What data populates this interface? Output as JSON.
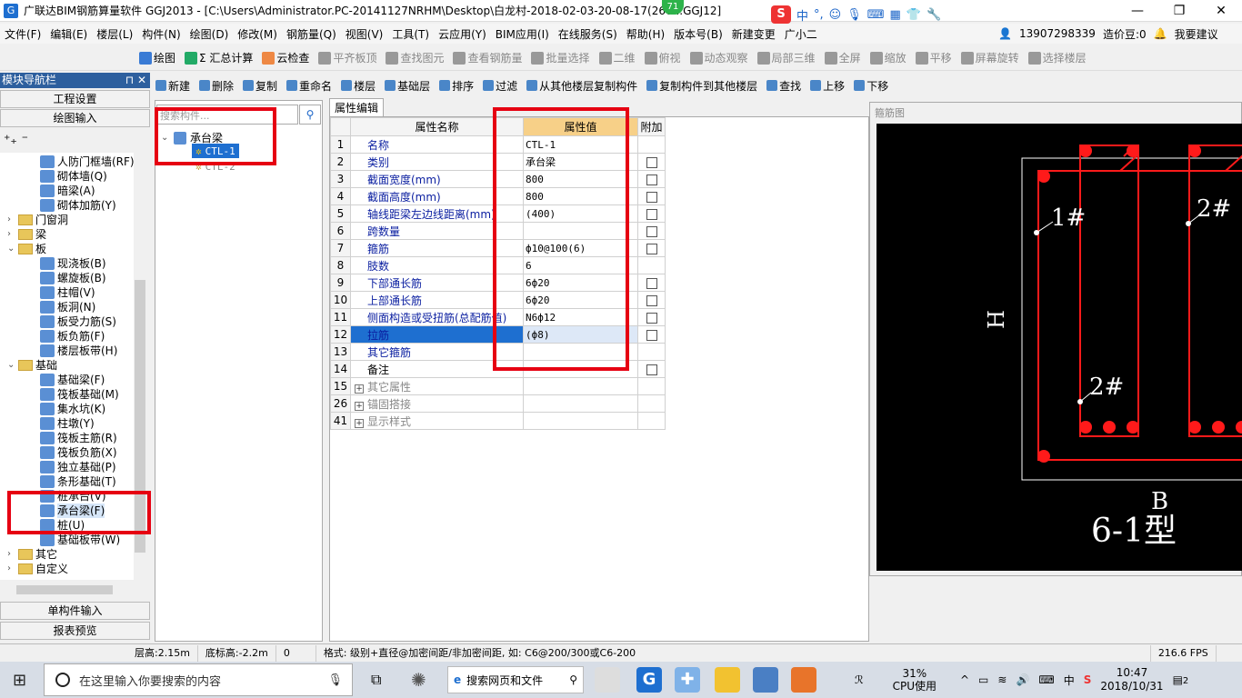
{
  "window": {
    "title": "广联达BIM钢筋算量软件 GGJ2013 - [C:\\Users\\Administrator.PC-20141127NRHM\\Desktop\\白龙村-2018-02-03-20-08-17(260...GGJ12]",
    "badge": "71",
    "min": "—",
    "max": "❐",
    "close": "✕"
  },
  "ime": {
    "logo": "S",
    "lang": "中",
    "punct": "°,"
  },
  "menu": [
    "文件(F)",
    "编辑(E)",
    "楼层(L)",
    "构件(N)",
    "绘图(D)",
    "修改(M)",
    "钢筋量(Q)",
    "视图(V)",
    "工具(T)",
    "云应用(Y)",
    "BIM应用(I)",
    "在线服务(S)",
    "帮助(H)",
    "版本号(B)",
    "新建变更",
    "广小二"
  ],
  "menu_right": {
    "phone": "13907298339",
    "price": "造价豆:0",
    "suggest": "我要建议"
  },
  "toolbar1": [
    {
      "label": "绘图",
      "dis": false
    },
    {
      "label": "Σ 汇总计算",
      "dis": false
    },
    {
      "label": "云检查",
      "dis": false
    },
    {
      "label": "平齐板顶",
      "dis": true
    },
    {
      "label": "查找图元",
      "dis": true
    },
    {
      "label": "查看钢筋量",
      "dis": true
    },
    {
      "label": "批量选择",
      "dis": true
    },
    {
      "label": "二维",
      "dis": true
    },
    {
      "label": "俯视",
      "dis": true
    },
    {
      "label": "动态观察",
      "dis": true
    },
    {
      "label": "局部三维",
      "dis": true
    },
    {
      "label": "全屏",
      "dis": true
    },
    {
      "label": "缩放",
      "dis": true
    },
    {
      "label": "平移",
      "dis": true
    },
    {
      "label": "屏幕旋转",
      "dis": true
    },
    {
      "label": "选择楼层",
      "dis": true
    }
  ],
  "toolbar2": [
    {
      "label": "新建"
    },
    {
      "label": "删除"
    },
    {
      "label": "复制"
    },
    {
      "label": "重命名"
    },
    {
      "label": "楼层"
    },
    {
      "label": "基础层"
    },
    {
      "label": "排序"
    },
    {
      "label": "过滤"
    },
    {
      "label": "从其他楼层复制构件"
    },
    {
      "label": "复制构件到其他楼层"
    },
    {
      "label": "查找"
    },
    {
      "label": "上移"
    },
    {
      "label": "下移"
    }
  ],
  "nav": {
    "title": "模块导航栏",
    "pin": "⊓ ✕",
    "setup": "工程设置",
    "draw_input": "绘图输入",
    "single_input": "单构件输入",
    "report": "报表预览",
    "tree": [
      {
        "label": "人防门框墙(RF)",
        "lvl": 2,
        "type": "item"
      },
      {
        "label": "砌体墙(Q)",
        "lvl": 2,
        "type": "item"
      },
      {
        "label": "暗梁(A)",
        "lvl": 2,
        "type": "item"
      },
      {
        "label": "砌体加筋(Y)",
        "lvl": 2,
        "type": "item"
      },
      {
        "label": "门窗洞",
        "lvl": 1,
        "type": "folder",
        "exp": "›"
      },
      {
        "label": "梁",
        "lvl": 1,
        "type": "folder",
        "exp": "›"
      },
      {
        "label": "板",
        "lvl": 1,
        "type": "folder",
        "exp": "⌄"
      },
      {
        "label": "现浇板(B)",
        "lvl": 2,
        "type": "item"
      },
      {
        "label": "螺旋板(B)",
        "lvl": 2,
        "type": "item"
      },
      {
        "label": "柱帽(V)",
        "lvl": 2,
        "type": "item"
      },
      {
        "label": "板洞(N)",
        "lvl": 2,
        "type": "item"
      },
      {
        "label": "板受力筋(S)",
        "lvl": 2,
        "type": "item"
      },
      {
        "label": "板负筋(F)",
        "lvl": 2,
        "type": "item"
      },
      {
        "label": "楼层板带(H)",
        "lvl": 2,
        "type": "item"
      },
      {
        "label": "基础",
        "lvl": 1,
        "type": "folder",
        "exp": "⌄"
      },
      {
        "label": "基础梁(F)",
        "lvl": 2,
        "type": "item"
      },
      {
        "label": "筏板基础(M)",
        "lvl": 2,
        "type": "item"
      },
      {
        "label": "集水坑(K)",
        "lvl": 2,
        "type": "item"
      },
      {
        "label": "柱墩(Y)",
        "lvl": 2,
        "type": "item"
      },
      {
        "label": "筏板主筋(R)",
        "lvl": 2,
        "type": "item"
      },
      {
        "label": "筏板负筋(X)",
        "lvl": 2,
        "type": "item"
      },
      {
        "label": "独立基础(P)",
        "lvl": 2,
        "type": "item"
      },
      {
        "label": "条形基础(T)",
        "lvl": 2,
        "type": "item"
      },
      {
        "label": "桩承台(V)",
        "lvl": 2,
        "type": "item"
      },
      {
        "label": "承台梁(F)",
        "lvl": 2,
        "type": "item",
        "sel": true
      },
      {
        "label": "桩(U)",
        "lvl": 2,
        "type": "item"
      },
      {
        "label": "基础板带(W)",
        "lvl": 2,
        "type": "item"
      },
      {
        "label": "其它",
        "lvl": 1,
        "type": "folder",
        "exp": "›"
      },
      {
        "label": "自定义",
        "lvl": 1,
        "type": "folder",
        "exp": "›"
      }
    ]
  },
  "components": {
    "search_placeholder": "搜索构件...",
    "root": "承台梁",
    "items": [
      "CTL-1",
      "CTL-2"
    ]
  },
  "props": {
    "tab": "属性编辑",
    "headers": [
      "属性名称",
      "属性值",
      "附加"
    ],
    "rows": [
      {
        "n": "1",
        "name": "名称",
        "val": "CTL-1",
        "cb": false,
        "color": "blue"
      },
      {
        "n": "2",
        "name": "类别",
        "val": "承台梁",
        "cb": true,
        "color": "blue"
      },
      {
        "n": "3",
        "name": "截面宽度(mm)",
        "val": "800",
        "cb": true,
        "color": "blue"
      },
      {
        "n": "4",
        "name": "截面高度(mm)",
        "val": "800",
        "cb": true,
        "color": "blue"
      },
      {
        "n": "5",
        "name": "轴线距梁左边线距离(mm)",
        "val": "(400)",
        "cb": true,
        "color": "blue"
      },
      {
        "n": "6",
        "name": "跨数量",
        "val": "",
        "cb": true,
        "color": "blue"
      },
      {
        "n": "7",
        "name": "箍筋",
        "val": "ф10@100(6)",
        "cb": true,
        "color": "blue"
      },
      {
        "n": "8",
        "name": "肢数",
        "val": "6",
        "cb": false,
        "color": "blue"
      },
      {
        "n": "9",
        "name": "下部通长筋",
        "val": "6ф20",
        "cb": true,
        "color": "blue"
      },
      {
        "n": "10",
        "name": "上部通长筋",
        "val": "6ф20",
        "cb": true,
        "color": "blue"
      },
      {
        "n": "11",
        "name": "侧面构造或受扭筋(总配筋值)",
        "val": "N6ф12",
        "cb": true,
        "color": "blue"
      },
      {
        "n": "12",
        "name": "拉筋",
        "val": "(ф8)",
        "cb": true,
        "color": "blue",
        "sel": true
      },
      {
        "n": "13",
        "name": "其它箍筋",
        "val": "",
        "cb": false,
        "color": "blue"
      },
      {
        "n": "14",
        "name": "备注",
        "val": "",
        "cb": true,
        "color": "black"
      },
      {
        "n": "15",
        "name": "其它属性",
        "val": "",
        "cb": false,
        "color": "gray",
        "plus": true
      },
      {
        "n": "26",
        "name": "锚固搭接",
        "val": "",
        "cb": false,
        "color": "gray",
        "plus": true
      },
      {
        "n": "41",
        "name": "显示样式",
        "val": "",
        "cb": false,
        "color": "gray",
        "plus": true
      }
    ]
  },
  "drawing": {
    "title": "箍筋图",
    "label_1": "1#",
    "label_2a": "2#",
    "label_2b": "2#",
    "H": "H",
    "B": "B",
    "type": "6-1型",
    "bg": "#000000",
    "rebar": "#ff1a1a"
  },
  "status": {
    "floor_h": "层高:2.15m",
    "bottom": "底标高:-2.2m",
    "zero": "0",
    "hint": "格式: 级别+直径@加密间距/非加密间距, 如: C6@200/300或C6-200",
    "fps": "216.6 FPS"
  },
  "taskbar": {
    "search": "在这里输入你要搜索的内容",
    "web_search": "搜索网页和文件",
    "cpu": "31%",
    "cpu_label": "CPU使用",
    "lang": "中",
    "time": "10:47",
    "date": "2018/10/31",
    "notif": "2"
  }
}
